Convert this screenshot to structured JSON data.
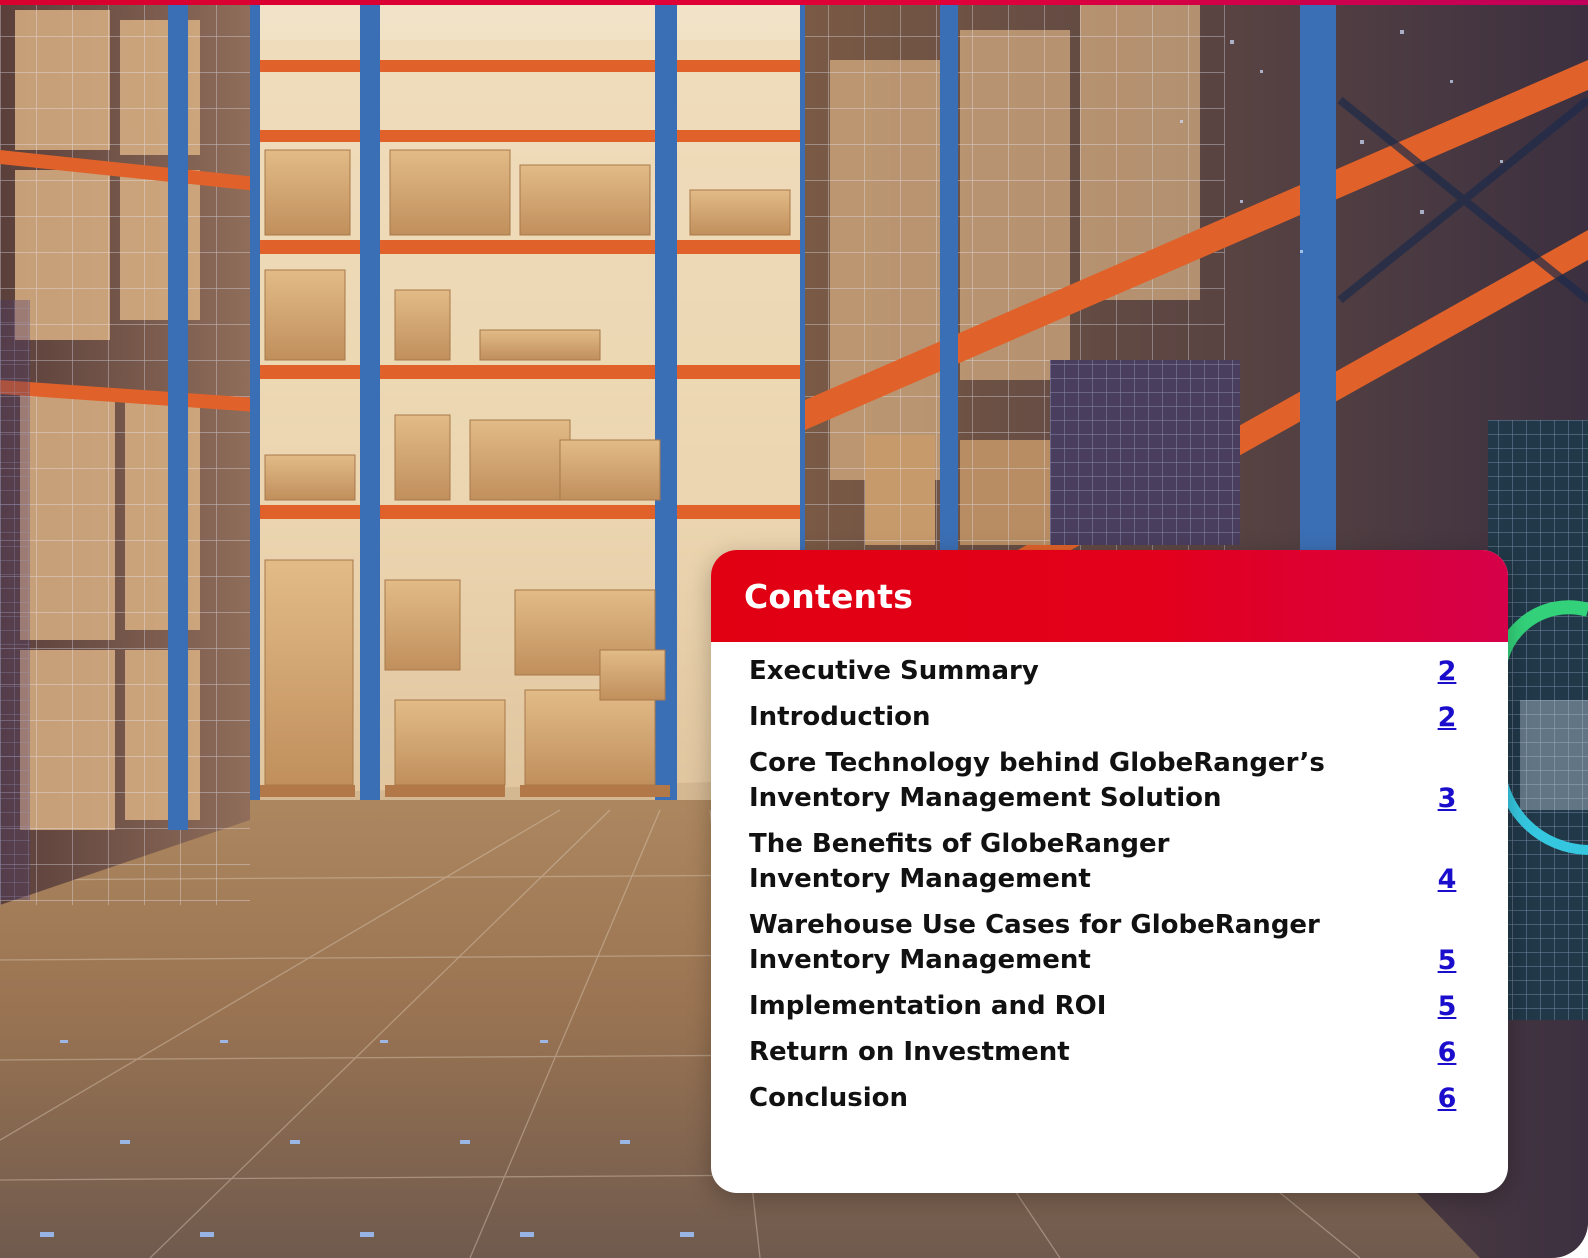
{
  "toc": {
    "title": "Contents",
    "items": [
      {
        "label": "Executive Summary",
        "page": "2"
      },
      {
        "label": "Introduction",
        "page": "2"
      },
      {
        "label": "Core Technology behind GlobeRanger’s\nInventory Management Solution",
        "page": "3"
      },
      {
        "label": "The Benefits of GlobeRanger\nInventory Management",
        "page": "4"
      },
      {
        "label": "Warehouse Use Cases for GlobeRanger\nInventory Management",
        "page": "5"
      },
      {
        "label": "Implementation and ROI",
        "page": "5"
      },
      {
        "label": "Return on Investment",
        "page": "6"
      },
      {
        "label": "Conclusion",
        "page": "6"
      }
    ]
  },
  "colors": {
    "accent_red": "#e3001b",
    "link_blue": "#1a0dcc"
  }
}
